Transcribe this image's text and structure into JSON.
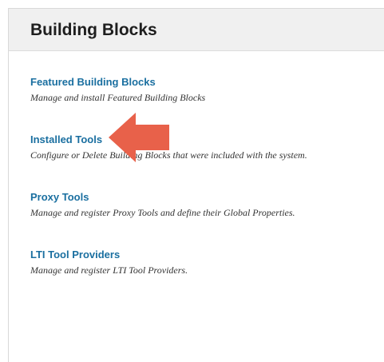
{
  "panel": {
    "title": "Building Blocks"
  },
  "items": [
    {
      "label": "Featured Building Blocks",
      "description": "Manage and install Featured Building Blocks"
    },
    {
      "label": "Installed Tools",
      "description": "Configure or Delete Building Blocks that were included with the system."
    },
    {
      "label": "Proxy Tools",
      "description": "Manage and register Proxy Tools and define their Global Properties."
    },
    {
      "label": "LTI Tool Providers",
      "description": "Manage and register LTI Tool Providers."
    }
  ],
  "annotation": {
    "icon": "arrow-left-icon",
    "color": "#e8614a"
  },
  "colors": {
    "link": "#1a6fa0",
    "header_bg": "#f0f0f0"
  }
}
